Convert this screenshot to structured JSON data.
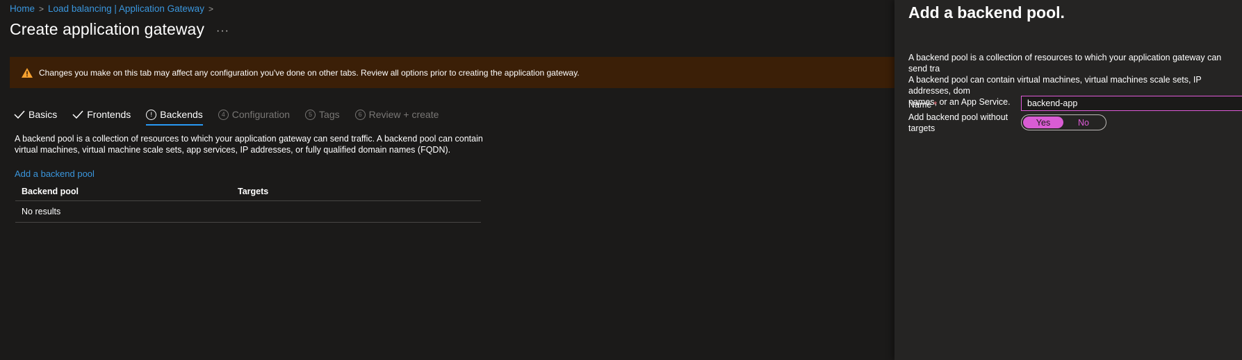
{
  "breadcrumb": {
    "items": [
      "Home",
      "Load balancing | Application Gateway"
    ],
    "separator": ">"
  },
  "page": {
    "title": "Create application gateway",
    "more": "···"
  },
  "warning": {
    "text": "Changes you make on this tab may affect any configuration you've done on other tabs. Review all options prior to creating the application gateway."
  },
  "tabs": [
    {
      "label": "Basics",
      "state": "done"
    },
    {
      "label": "Frontends",
      "state": "done"
    },
    {
      "label": "Backends",
      "state": "active",
      "number": "!"
    },
    {
      "label": "Configuration",
      "state": "disabled",
      "number": "4"
    },
    {
      "label": "Tags",
      "state": "disabled",
      "number": "5"
    },
    {
      "label": "Review + create",
      "state": "disabled",
      "number": "6"
    }
  ],
  "main": {
    "description": "A backend pool is a collection of resources to which your application gateway can send traffic. A backend pool can contain virtual machines, virtual machine scale sets, app services, IP addresses, or fully qualified domain names (FQDN).",
    "add_link": "Add a backend pool",
    "table": {
      "columns": [
        "Backend pool",
        "Targets"
      ],
      "empty_text": "No results"
    }
  },
  "panel": {
    "title": "Add a backend pool.",
    "description": "A backend pool is a collection of resources to which your application gateway can send tra\nA backend pool can contain virtual machines, virtual machines scale sets, IP addresses, dom\nnames, or an App Service.",
    "name_label": "Name",
    "name_required": "*",
    "name_value": "backend-app",
    "without_targets_label": "Add backend pool without targets",
    "toggle": {
      "yes": "Yes",
      "no": "No",
      "selected": "Yes"
    }
  },
  "colors": {
    "link": "#3a96dd",
    "accent": "#d95cd4",
    "warning_bg": "#3b1f07",
    "active_tab_underline": "#2899f5"
  }
}
